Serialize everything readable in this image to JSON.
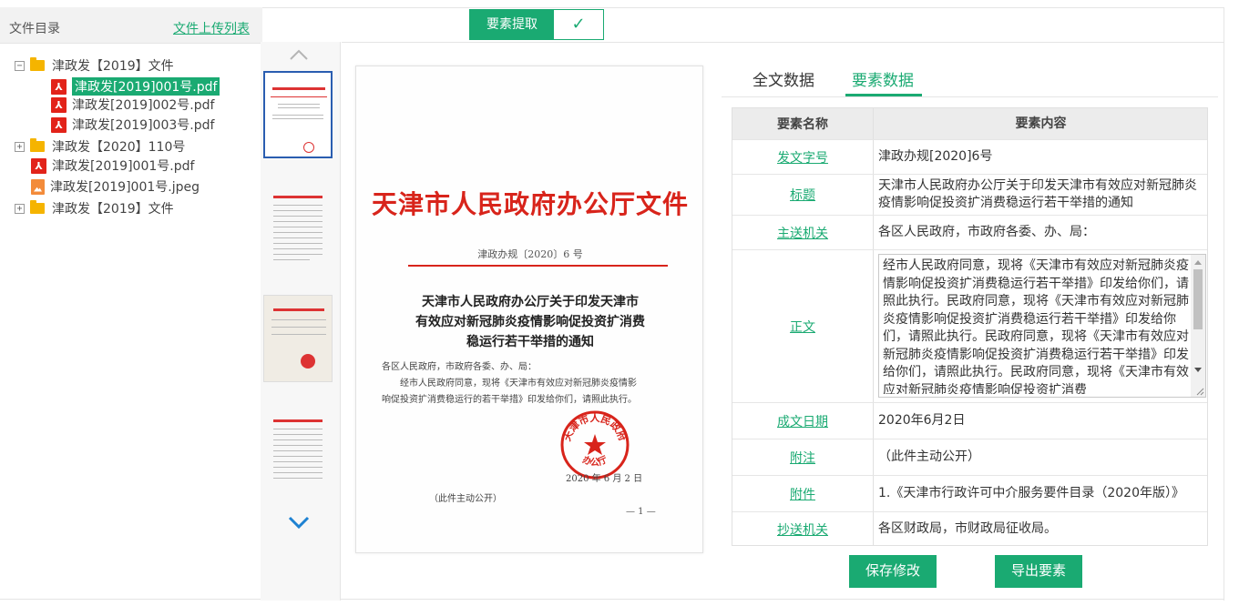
{
  "left_panel": {
    "title": "文件目录",
    "upload_list_link": "文件上传列表",
    "tree": [
      {
        "type": "folder",
        "label": "津政发【2019】文件",
        "toggle": "−"
      },
      {
        "type": "pdf",
        "label": "津政发[2019]001号.pdf",
        "selected": true
      },
      {
        "type": "pdf",
        "label": "津政发[2019]002号.pdf"
      },
      {
        "type": "pdf",
        "label": "津政发[2019]003号.pdf"
      },
      {
        "type": "folder",
        "label": "津政发【2020】110号",
        "toggle": "+"
      },
      {
        "type": "pdf",
        "label": "津政发[2019]001号.pdf"
      },
      {
        "type": "jpeg",
        "label": "津政发[2019]001号.jpeg"
      },
      {
        "type": "folder",
        "label": "津政发【2019】文件",
        "toggle": "+"
      }
    ]
  },
  "toolbar": {
    "extract_label": "要素提取",
    "extract_check": "✓"
  },
  "document": {
    "title": "天津市人民政府办公厅文件",
    "number": "津政办规〔2020〕6 号",
    "subject_lines": [
      "天津市人民政府办公厅关于印发天津市",
      "有效应对新冠肺炎疫情影响促投资扩消费",
      "稳运行若干举措的通知"
    ],
    "addressee": "各区人民政府，市政府各委、办、局：",
    "body_line1": "经市人民政府同意，现将《天津市有效应对新冠肺炎疫情影",
    "body_line2": "响促投资扩消费稳运行的若干举措》印发给你们，请照此执行。",
    "seal_text_top": "天津市人民政府",
    "seal_text_bottom": "办公厅",
    "date": "2020 年 6 月 2 日",
    "note": "（此件主动公开）",
    "page_no": "— 1 —"
  },
  "tabs": {
    "fulltext": "全文数据",
    "elements": "要素数据"
  },
  "table": {
    "header_name": "要素名称",
    "header_content": "要素内容",
    "rows": [
      {
        "name": "发文字号",
        "value": "津政办规[2020]6号"
      },
      {
        "name": "标题",
        "value": "天津市人民政府办公厅关于印发天津市有效应对新冠肺炎疫情影响促投资扩消费稳运行若干举措的通知"
      },
      {
        "name": "主送机关",
        "value": "各区人民政府，市政府各委、办、局："
      },
      {
        "name": "正文",
        "value": "经市人民政府同意，现将《天津市有效应对新冠肺炎疫情影响促投资扩消费稳运行若干举措》印发给你们，请照此执行。民政府同意，现将《天津市有效应对新冠肺炎疫情影响促投资扩消费稳运行若干举措》印发给你们，请照此执行。民政府同意，现将《天津市有效应对新冠肺炎疫情影响促投资扩消费稳运行若干举措》印发给你们，请照此执行。民政府同意，现将《天津市有效应对新冠肺炎疫情影响促投资扩消费"
      },
      {
        "name": "成文日期",
        "value": "2020年6月2日"
      },
      {
        "name": "附注",
        "value": "（此件主动公开）"
      },
      {
        "name": "附件",
        "value": "1.《天津市行政许可中介服务要件目录（2020年版）》"
      },
      {
        "name": "抄送机关",
        "value": "各区财政局，市财政局征收局。"
      }
    ]
  },
  "actions": {
    "save": "保存修改",
    "export": "导出要素"
  },
  "colors": {
    "accent": "#1aaa72",
    "doc_red": "#d8241b"
  }
}
